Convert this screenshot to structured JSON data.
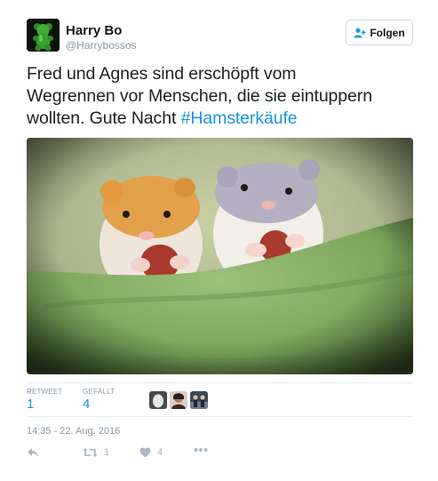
{
  "user": {
    "name": "Harry Bo",
    "handle": "@Harrybossos",
    "avatar_icon": "green-gummy-bear-avatar"
  },
  "follow_button": {
    "label": "Folgen",
    "icon": "add-user-icon"
  },
  "tweet": {
    "text_line1": "Fred und Agnes sind erschöpft vom",
    "text_line2": "Wegrennen vor Menschen, die sie eintuppern",
    "text_line3_prefix": "wollten. Gute Nacht ",
    "hashtag": "#Hamsterkäufe"
  },
  "stats": {
    "retweet_label": "RETWEET",
    "retweet_count": "1",
    "like_label": "GEFÄLLT",
    "like_count": "4"
  },
  "timestamp": "14:35 - 22. Aug. 2016",
  "actions": {
    "reply_icon": "reply-icon",
    "retweet_icon": "retweet-icon",
    "retweet_count": "1",
    "like_icon": "heart-icon",
    "like_count": "4",
    "more_icon": "more-icon"
  },
  "colors": {
    "link": "#1b95e0",
    "muted": "#8899a6",
    "action": "#aab8c2"
  }
}
